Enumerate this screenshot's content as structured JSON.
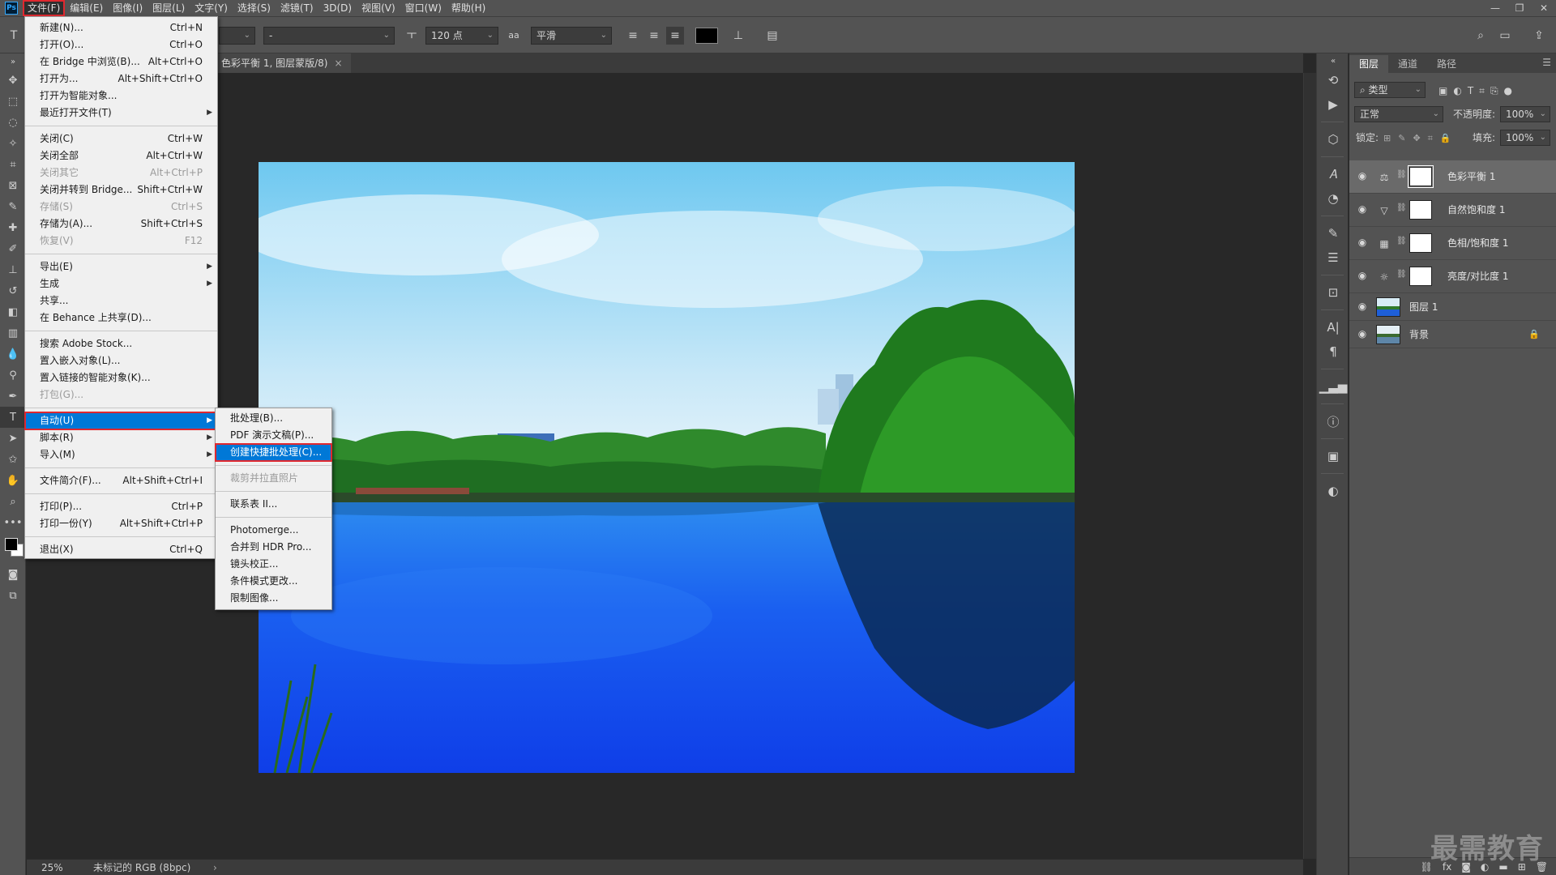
{
  "menubar": {
    "logo": "Ps",
    "items": [
      "文件(F)",
      "编辑(E)",
      "图像(I)",
      "图层(L)",
      "文字(Y)",
      "选择(S)",
      "滤镜(T)",
      "3D(D)",
      "视图(V)",
      "窗口(W)",
      "帮助(H)"
    ]
  },
  "options": {
    "font_style_value": "-",
    "font_size_value": "120 点",
    "aa_label": "aa",
    "antialias_value": "平滑"
  },
  "document": {
    "tab_title": "色彩平衡 1, 图层蒙版/8)",
    "close": "×"
  },
  "status": {
    "zoom": "25%",
    "info": "未标记的 RGB (8bpc)",
    "arrow": "›"
  },
  "layers_panel": {
    "tabs": [
      "图层",
      "通道",
      "路径"
    ],
    "filter_select": "类型",
    "blend_mode": "正常",
    "opacity_label": "不透明度:",
    "opacity_value": "100%",
    "lock_label": "锁定:",
    "fill_label": "填充:",
    "fill_value": "100%",
    "layers": [
      {
        "name": "色彩平衡 1",
        "icon": "balance-icon"
      },
      {
        "name": "自然饱和度 1",
        "icon": "vibrance-icon"
      },
      {
        "name": "色相/饱和度 1",
        "icon": "hue-sat-icon"
      },
      {
        "name": "亮度/对比度 1",
        "icon": "brightness-icon"
      },
      {
        "name": "图层 1"
      },
      {
        "name": "背景"
      }
    ]
  },
  "file_menu": {
    "groups": [
      [
        {
          "label": "新建(N)...",
          "shortcut": "Ctrl+N"
        },
        {
          "label": "打开(O)...",
          "shortcut": "Ctrl+O"
        },
        {
          "label": "在 Bridge 中浏览(B)...",
          "shortcut": "Alt+Ctrl+O"
        },
        {
          "label": "打开为...",
          "shortcut": "Alt+Shift+Ctrl+O"
        },
        {
          "label": "打开为智能对象...",
          "shortcut": ""
        },
        {
          "label": "最近打开文件(T)",
          "shortcut": "",
          "submenu": true
        }
      ],
      [
        {
          "label": "关闭(C)",
          "shortcut": "Ctrl+W"
        },
        {
          "label": "关闭全部",
          "shortcut": "Alt+Ctrl+W"
        },
        {
          "label": "关闭其它",
          "shortcut": "Alt+Ctrl+P",
          "disabled": true
        },
        {
          "label": "关闭并转到 Bridge...",
          "shortcut": "Shift+Ctrl+W"
        },
        {
          "label": "存储(S)",
          "shortcut": "Ctrl+S",
          "disabled": true
        },
        {
          "label": "存储为(A)...",
          "shortcut": "Shift+Ctrl+S"
        },
        {
          "label": "恢复(V)",
          "shortcut": "F12",
          "disabled": true
        }
      ],
      [
        {
          "label": "导出(E)",
          "shortcut": "",
          "submenu": true
        },
        {
          "label": "生成",
          "shortcut": "",
          "submenu": true
        },
        {
          "label": "共享...",
          "shortcut": ""
        },
        {
          "label": "在 Behance 上共享(D)...",
          "shortcut": ""
        }
      ],
      [
        {
          "label": "搜索 Adobe Stock...",
          "shortcut": ""
        },
        {
          "label": "置入嵌入对象(L)...",
          "shortcut": ""
        },
        {
          "label": "置入链接的智能对象(K)...",
          "shortcut": ""
        },
        {
          "label": "打包(G)...",
          "shortcut": "",
          "disabled": true
        }
      ],
      [
        {
          "label": "自动(U)",
          "shortcut": "",
          "submenu": true,
          "highlighted": true
        },
        {
          "label": "脚本(R)",
          "shortcut": "",
          "submenu": true
        },
        {
          "label": "导入(M)",
          "shortcut": "",
          "submenu": true
        }
      ],
      [
        {
          "label": "文件简介(F)...",
          "shortcut": "Alt+Shift+Ctrl+I"
        }
      ],
      [
        {
          "label": "打印(P)...",
          "shortcut": "Ctrl+P"
        },
        {
          "label": "打印一份(Y)",
          "shortcut": "Alt+Shift+Ctrl+P"
        }
      ],
      [
        {
          "label": "退出(X)",
          "shortcut": "Ctrl+Q"
        }
      ]
    ]
  },
  "auto_submenu": {
    "groups": [
      [
        {
          "label": "批处理(B)..."
        },
        {
          "label": "PDF 演示文稿(P)..."
        },
        {
          "label": "创建快捷批处理(C)...",
          "highlighted": true
        }
      ],
      [
        {
          "label": "裁剪并拉直照片",
          "disabled": true
        }
      ],
      [
        {
          "label": "联系表 II..."
        }
      ],
      [
        {
          "label": "Photomerge..."
        },
        {
          "label": "合并到 HDR Pro..."
        },
        {
          "label": "镜头校正..."
        },
        {
          "label": "条件模式更改..."
        },
        {
          "label": "限制图像..."
        }
      ]
    ]
  },
  "watermark": "最需教育",
  "colors": {
    "highlight": "#0078d7",
    "annotation_red": "#e0282f"
  }
}
